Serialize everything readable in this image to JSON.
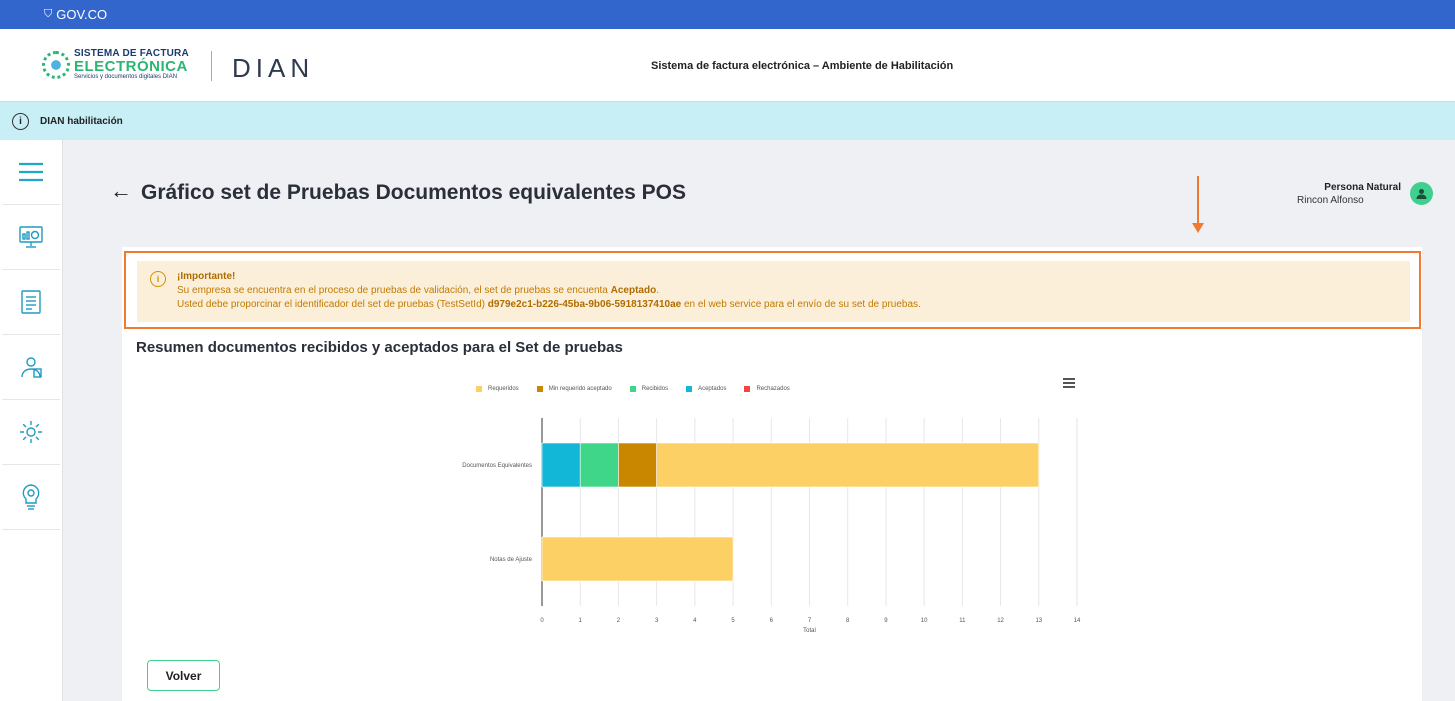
{
  "gov_bar": {
    "label": "GOV.CO"
  },
  "header": {
    "logo_line1": "SISTEMA DE FACTURA",
    "logo_line2": "ELECTRÓNICA",
    "logo_line3": "Servicios y documentos digitales DIAN",
    "dian_logo": "DIAN",
    "title": "Sistema de factura electrónica – Ambiente de Habilitación"
  },
  "info_bar": {
    "label": "DIAN habilitación"
  },
  "sidebar": {
    "items": [
      {
        "icon": "menu-icon"
      },
      {
        "icon": "dashboard-icon"
      },
      {
        "icon": "document-icon"
      },
      {
        "icon": "user-settings-icon"
      },
      {
        "icon": "gear-icon"
      },
      {
        "icon": "lightbulb-icon"
      }
    ]
  },
  "page": {
    "title": "Gráfico set de Pruebas Documentos equivalentes POS",
    "user_role": "Persona Natural",
    "user_name": "Rincon Alfonso"
  },
  "alert": {
    "heading": "¡Importante!",
    "line1_prefix": "Su empresa se encuentra en el proceso de pruebas de validación, el set de pruebas se encuenta ",
    "line1_status": "Aceptado",
    "line1_suffix": ".",
    "line2_prefix": "Usted debe proporcinar el identificador del set de pruebas (TestSetId) ",
    "line2_id": "d979e2c1-b226-45ba-9b06-5918137410ae",
    "line2_suffix": " en el web service para el envío de su set de pruebas."
  },
  "chart_section": {
    "title": "Resumen documentos recibidos y aceptados para el Set de pruebas"
  },
  "buttons": {
    "back": "Volver"
  },
  "chart_data": {
    "type": "bar",
    "orientation": "horizontal",
    "stacked": true,
    "categories": [
      "Documentos Equivalentes",
      "Notas de Ajuste"
    ],
    "series": [
      {
        "name": "Requeridos",
        "color": "#fdd066",
        "values": [
          10,
          5
        ]
      },
      {
        "name": "Min requerido aceptado",
        "color": "#c98700",
        "values": [
          1,
          0
        ]
      },
      {
        "name": "Recibidos",
        "color": "#3fd68a",
        "values": [
          1,
          0
        ]
      },
      {
        "name": "Aceptados",
        "color": "#12b6d6",
        "values": [
          1,
          0
        ]
      },
      {
        "name": "Rechazados",
        "color": "#f0483e",
        "values": [
          0,
          0
        ]
      }
    ],
    "stack_order": [
      "Aceptados",
      "Recibidos",
      "Min requerido aceptado",
      "Requeridos"
    ],
    "xlabel": "Total",
    "xlim": [
      0,
      14
    ],
    "xticks": [
      0,
      1,
      2,
      3,
      4,
      5,
      6,
      7,
      8,
      9,
      10,
      11,
      12,
      13,
      14
    ],
    "grid": true,
    "legend": "top"
  }
}
